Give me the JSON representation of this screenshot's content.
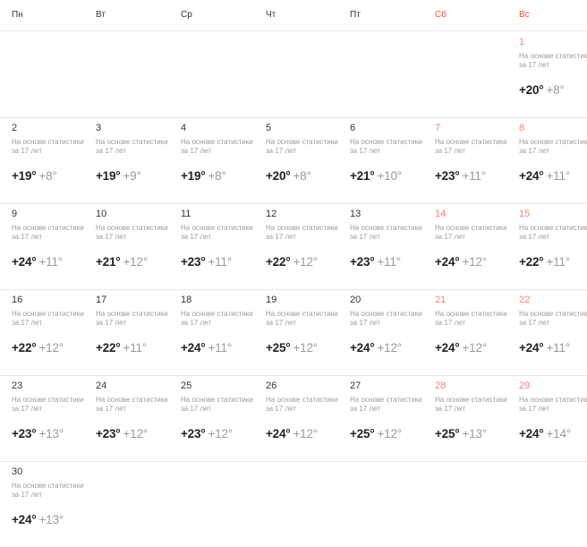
{
  "weekdays": [
    {
      "label": "Пн",
      "weekend": false
    },
    {
      "label": "Вт",
      "weekend": false
    },
    {
      "label": "Ср",
      "weekend": false
    },
    {
      "label": "Чт",
      "weekend": false
    },
    {
      "label": "Пт",
      "weekend": false
    },
    {
      "label": "Сб",
      "weekend": true
    },
    {
      "label": "Вс",
      "weekend": true
    }
  ],
  "note_text": "На основе статистики\nза 17 лет",
  "weeks": [
    [
      null,
      null,
      null,
      null,
      null,
      null,
      {
        "day": "1",
        "max": "+20°",
        "min": "+8°"
      }
    ],
    [
      {
        "day": "2",
        "max": "+19°",
        "min": "+8°"
      },
      {
        "day": "3",
        "max": "+19°",
        "min": "+9°"
      },
      {
        "day": "4",
        "max": "+19°",
        "min": "+8°"
      },
      {
        "day": "5",
        "max": "+20°",
        "min": "+8°"
      },
      {
        "day": "6",
        "max": "+21°",
        "min": "+10°"
      },
      {
        "day": "7",
        "max": "+23°",
        "min": "+11°"
      },
      {
        "day": "8",
        "max": "+24°",
        "min": "+11°"
      }
    ],
    [
      {
        "day": "9",
        "max": "+24°",
        "min": "+11°"
      },
      {
        "day": "10",
        "max": "+21°",
        "min": "+12°"
      },
      {
        "day": "11",
        "max": "+23°",
        "min": "+11°"
      },
      {
        "day": "12",
        "max": "+22°",
        "min": "+12°"
      },
      {
        "day": "13",
        "max": "+23°",
        "min": "+11°"
      },
      {
        "day": "14",
        "max": "+24°",
        "min": "+12°"
      },
      {
        "day": "15",
        "max": "+22°",
        "min": "+11°"
      }
    ],
    [
      {
        "day": "16",
        "max": "+22°",
        "min": "+12°"
      },
      {
        "day": "17",
        "max": "+22°",
        "min": "+11°"
      },
      {
        "day": "18",
        "max": "+24°",
        "min": "+11°"
      },
      {
        "day": "19",
        "max": "+25°",
        "min": "+12°"
      },
      {
        "day": "20",
        "max": "+24°",
        "min": "+12°"
      },
      {
        "day": "21",
        "max": "+24°",
        "min": "+12°"
      },
      {
        "day": "22",
        "max": "+24°",
        "min": "+11°"
      }
    ],
    [
      {
        "day": "23",
        "max": "+23°",
        "min": "+13°"
      },
      {
        "day": "24",
        "max": "+23°",
        "min": "+12°"
      },
      {
        "day": "25",
        "max": "+23°",
        "min": "+12°"
      },
      {
        "day": "26",
        "max": "+24°",
        "min": "+12°"
      },
      {
        "day": "27",
        "max": "+25°",
        "min": "+12°"
      },
      {
        "day": "28",
        "max": "+25°",
        "min": "+13°"
      },
      {
        "day": "29",
        "max": "+24°",
        "min": "+14°"
      }
    ],
    [
      {
        "day": "30",
        "max": "+24°",
        "min": "+13°"
      },
      null,
      null,
      null,
      null,
      null,
      null
    ]
  ]
}
